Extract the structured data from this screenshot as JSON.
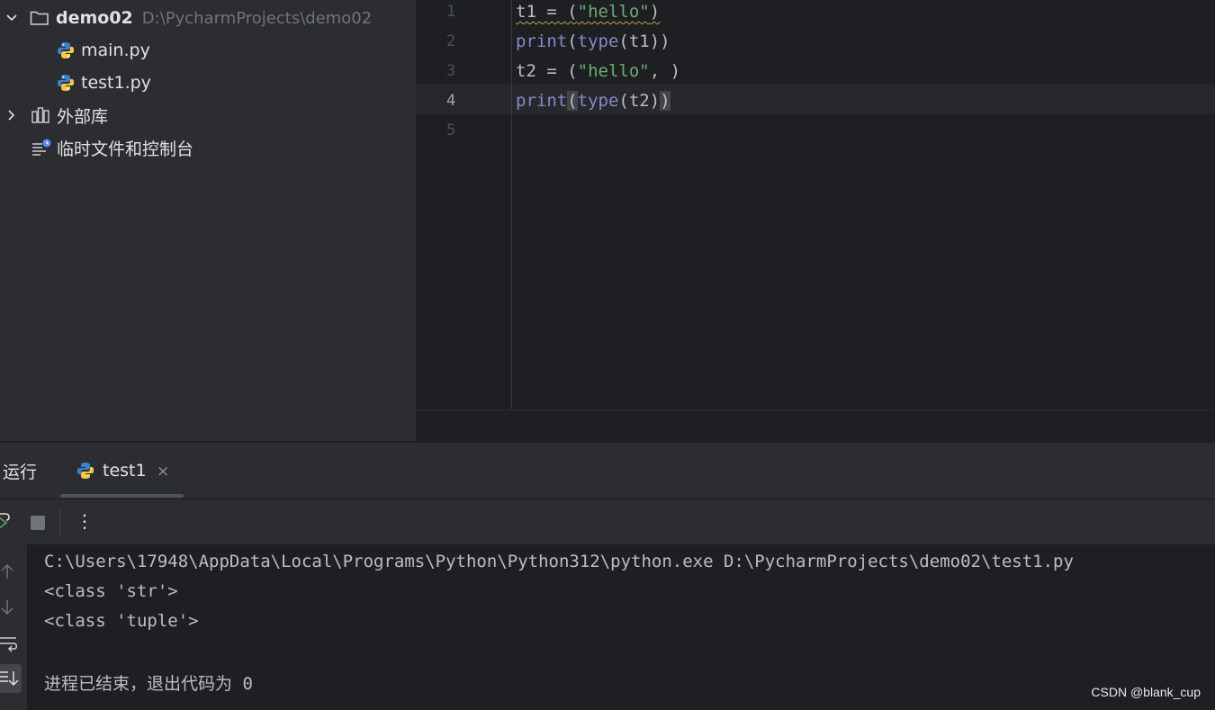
{
  "project": {
    "root_name": "demo02",
    "root_path": "D:\\PycharmProjects\\demo02",
    "files": [
      "main.py",
      "test1.py"
    ],
    "external_libs": "外部库",
    "scratches": "临时文件和控制台"
  },
  "editor": {
    "line_numbers": [
      "1",
      "2",
      "3",
      "4",
      "5"
    ],
    "lines": [
      {
        "a": "t1 = (",
        "b": "\"hello\"",
        "c": ")"
      },
      {
        "kw1": "print",
        "p1": "(",
        "kw2": "type",
        "rest": "(t1))"
      },
      {
        "a": "t2 = (",
        "b": "\"hello\"",
        "c": ", )"
      },
      {
        "kw1": "print",
        "p1": "(",
        "kw2": "type",
        "rest": "(t2)",
        "close": ")"
      }
    ]
  },
  "run": {
    "title": "运行",
    "tab_label": "test1",
    "close": "×",
    "more": "⋮",
    "console": [
      "C:\\Users\\17948\\AppData\\Local\\Programs\\Python\\Python312\\python.exe D:\\PycharmProjects\\demo02\\test1.py",
      "<class 'str'>",
      "<class 'tuple'>",
      "",
      "进程已结束，退出代码为 0"
    ]
  },
  "watermark": "CSDN @blank_cup",
  "colors": {
    "keyword": "#8888c6",
    "string": "#6aab73",
    "panel": "#2b2d30",
    "editor": "#1e1f22"
  }
}
